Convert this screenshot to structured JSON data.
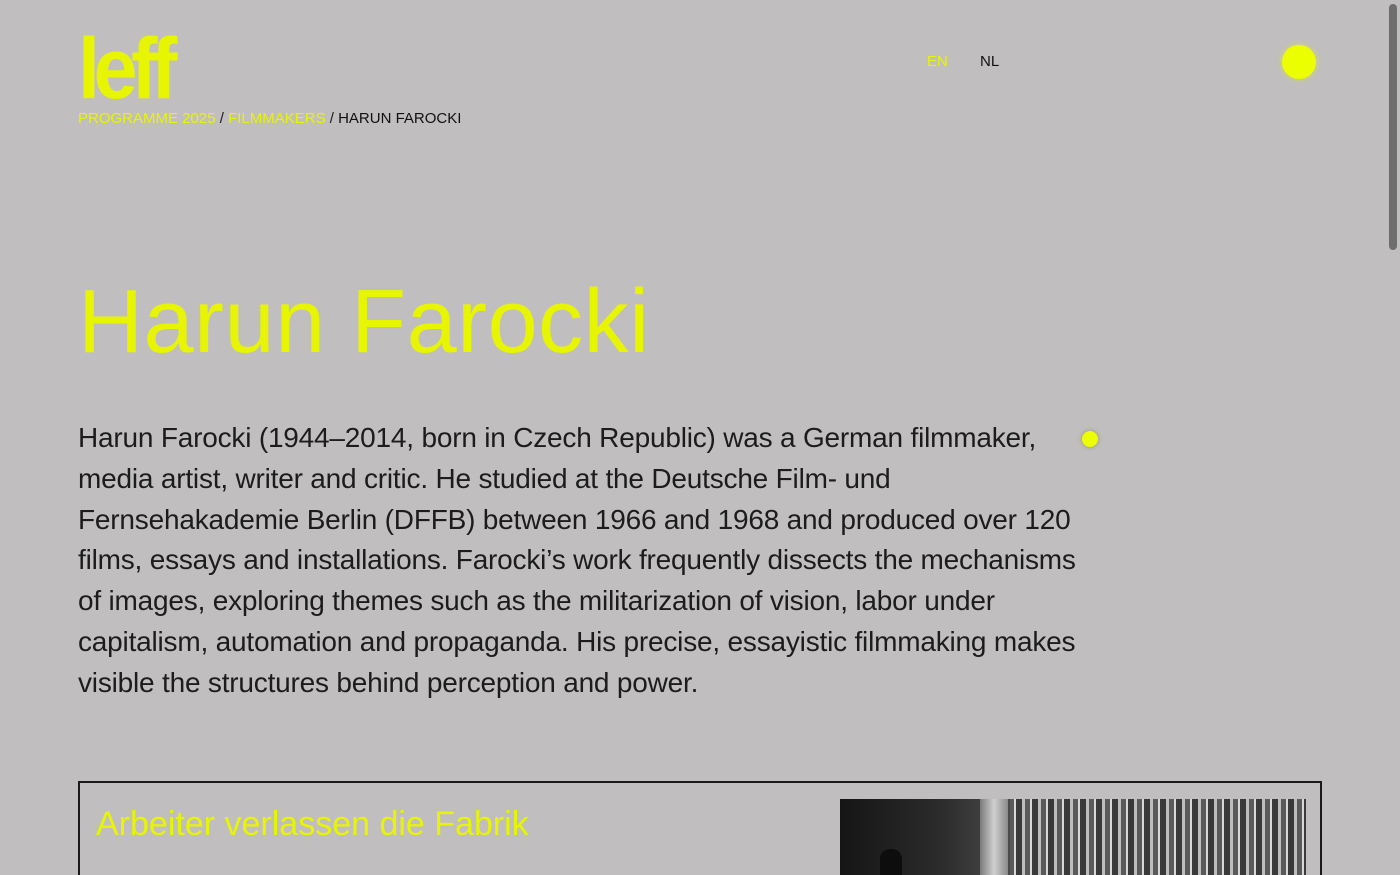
{
  "logo": {
    "text": "leff"
  },
  "breadcrumb": {
    "items": [
      {
        "label": "PROGRAMME 2025"
      },
      {
        "label": "FILMMAKERS"
      }
    ],
    "current": "HARUN FAROCKI",
    "separator": "/"
  },
  "language": {
    "options": [
      "EN",
      "NL"
    ],
    "active": "EN"
  },
  "filmmaker": {
    "name": "Harun Farocki",
    "bio": "Harun Farocki (1944–2014, born in Czech Republic) was a German filmmaker, media artist, writer and critic. He studied at the Deutsche Film- und Fernsehakademie Berlin (DFFB) between 1966 and 1968 and produced over 120 films, essays and installations. Farocki’s work frequently dissects the mechanisms of images, exploring themes such as the militarization of vision, labor under capitalism, automation and propaganda. His precise, essayistic filmmaking makes visible the structures behind perception and power."
  },
  "films": [
    {
      "title": "Arbeiter verlassen die Fabrik"
    }
  ],
  "colors": {
    "accent": "#e8f500",
    "background": "#c0bebf",
    "text": "#1a1a1a"
  },
  "icons": {
    "menu": "menu-dot-icon",
    "cursor": "cursor-dot-icon"
  }
}
